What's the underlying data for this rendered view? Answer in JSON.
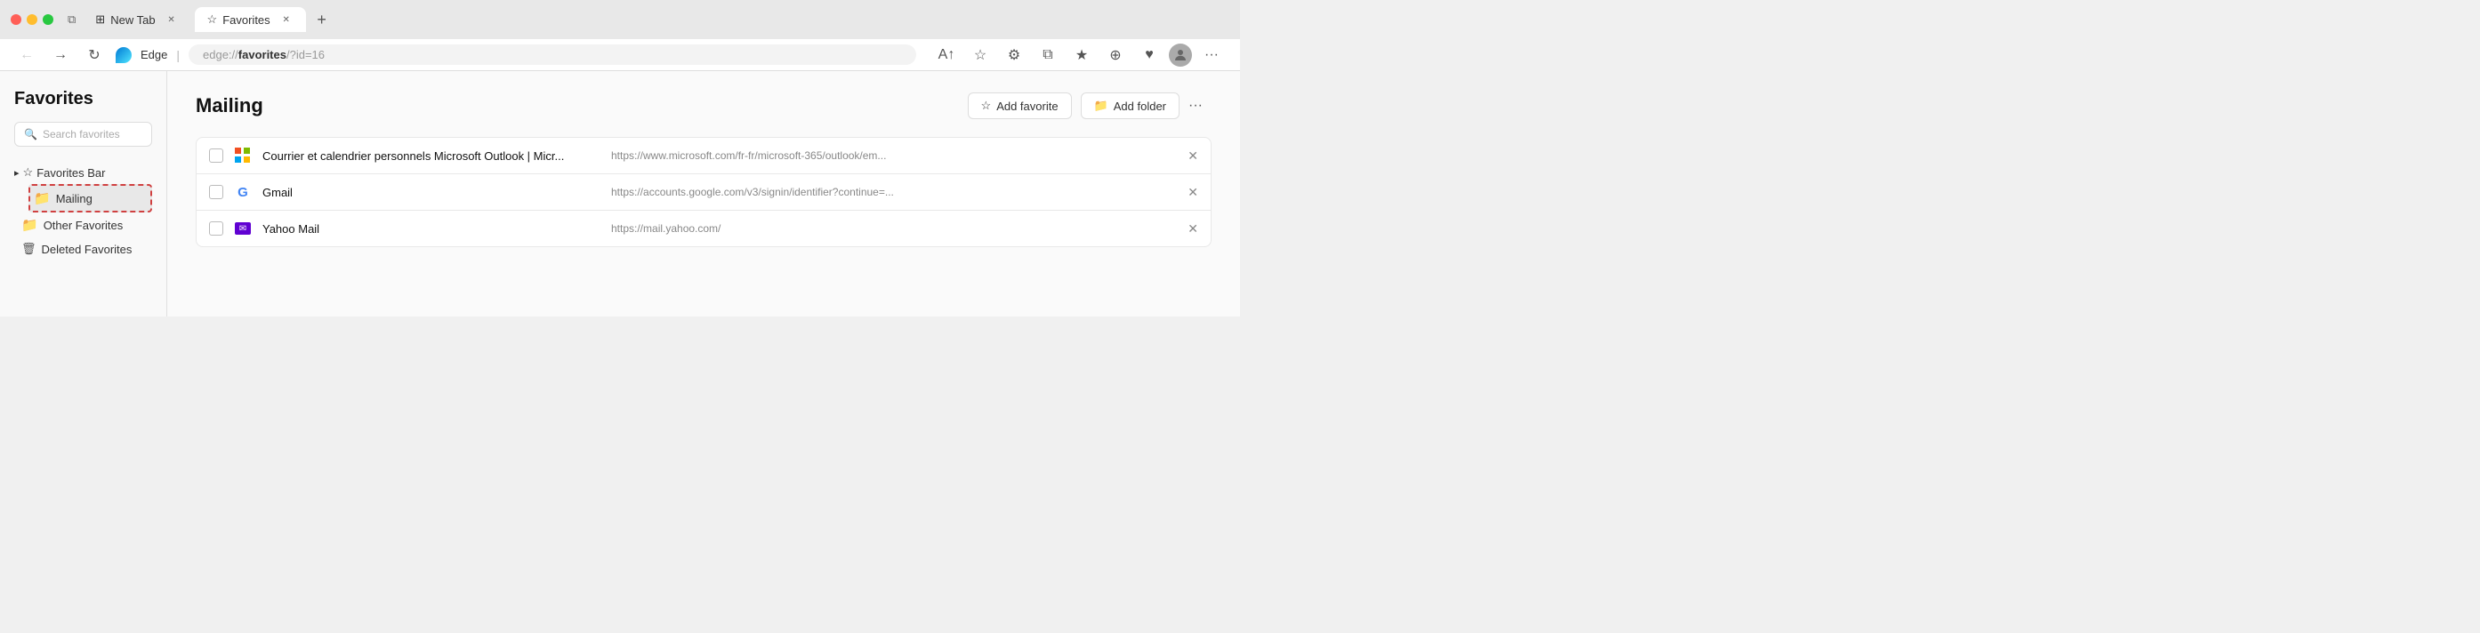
{
  "title_bar": {
    "tabs": [
      {
        "id": "new-tab",
        "label": "New Tab",
        "icon": "⊞",
        "active": false
      },
      {
        "id": "favorites",
        "label": "Favorites",
        "icon": "☆",
        "active": true
      }
    ],
    "new_tab_label": "+"
  },
  "address_bar": {
    "back_label": "←",
    "forward_label": "→",
    "refresh_label": "↻",
    "browser_name": "Edge",
    "address": "edge://favorites/?id=16",
    "address_protocol": "edge://",
    "address_path": "favorites",
    "address_params": "/?id=16",
    "more_label": "···"
  },
  "sidebar": {
    "title": "Favorites",
    "search_placeholder": "Search favorites",
    "items": [
      {
        "id": "favorites-bar",
        "label": "Favorites Bar",
        "type": "parent",
        "expanded": true
      },
      {
        "id": "mailing",
        "label": "Mailing",
        "type": "folder",
        "selected": true
      },
      {
        "id": "other-favorites",
        "label": "Other Favorites",
        "type": "folder",
        "selected": false
      },
      {
        "id": "deleted-favorites",
        "label": "Deleted Favorites",
        "type": "trash",
        "selected": false
      }
    ]
  },
  "content": {
    "title": "Mailing",
    "add_favorite_label": "Add favorite",
    "add_folder_label": "Add folder",
    "more_label": "···",
    "items": [
      {
        "id": "outlook",
        "name": "Courrier et calendrier personnels Microsoft Outlook | Micr...",
        "url": "https://www.microsoft.com/fr-fr/microsoft-365/outlook/em...",
        "icon_type": "microsoft"
      },
      {
        "id": "gmail",
        "name": "Gmail",
        "url": "https://accounts.google.com/v3/signin/identifier?continue=...",
        "icon_type": "google"
      },
      {
        "id": "yahoo-mail",
        "name": "Yahoo Mail",
        "url": "https://mail.yahoo.com/",
        "icon_type": "yahoo"
      }
    ]
  },
  "toolbar": {
    "icons": [
      "A↑",
      "☆",
      "⚙",
      "⧉",
      "☆",
      "⊕",
      "♥",
      "👤",
      "···"
    ]
  }
}
